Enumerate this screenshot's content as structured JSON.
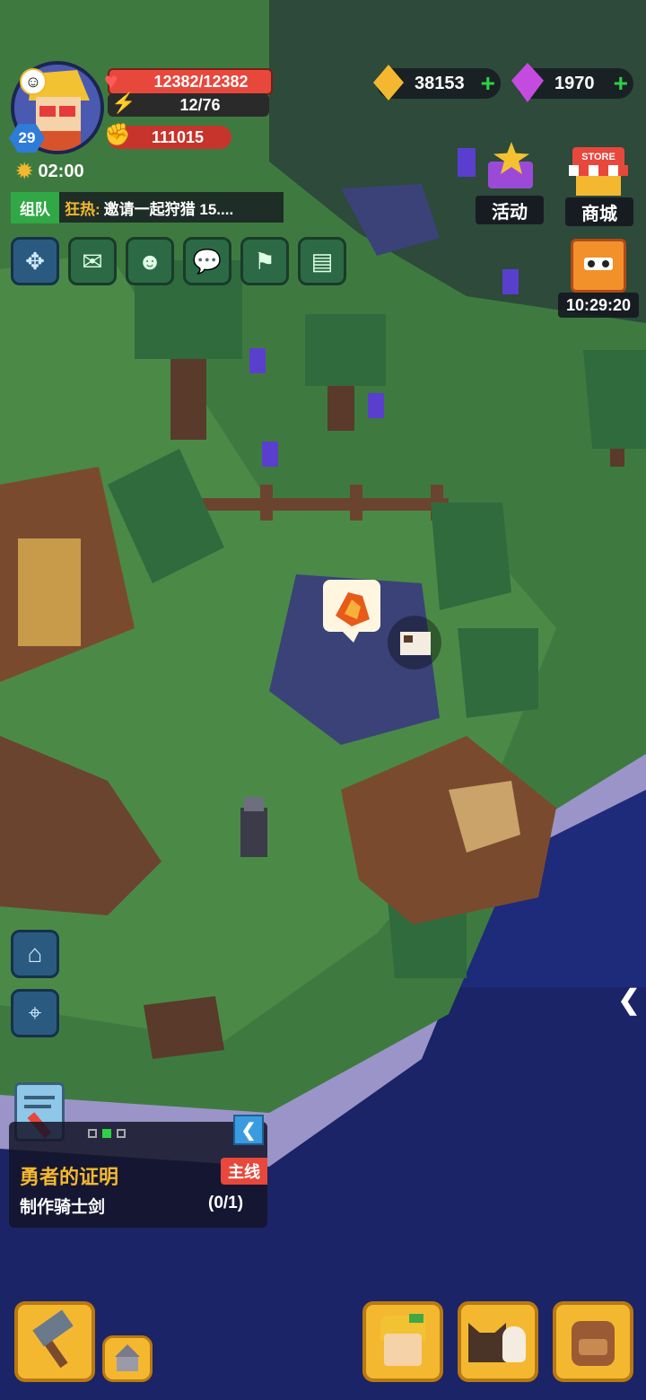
{
  "player": {
    "level": "29",
    "hp": "12382/12382",
    "energy": "12/76",
    "power": "111015",
    "timer": "02:00"
  },
  "resources": {
    "gold": "38153",
    "gems": "1970"
  },
  "team_chat": {
    "tag": "组队",
    "prefix": "狂热:",
    "message": "邀请一起狩猎 15...."
  },
  "top_right": {
    "events_label": "活动",
    "store_label": "商城",
    "store_sign": "STORE",
    "gift_timer": "10:29:20"
  },
  "quest": {
    "title": "勇者的证明",
    "badge": "主线",
    "task": "制作骑士剑",
    "progress": "(0/1)"
  },
  "colors": {
    "accent_red": "#e8473c",
    "gold": "#f4b830",
    "green_ui": "#2b6a45",
    "grass": "#3e7a40",
    "water": "#1e2a7a"
  },
  "icons": {
    "menu": [
      "expand-icon",
      "mail-icon",
      "friends-icon",
      "chat-icon",
      "map-icon",
      "clipboard-icon"
    ],
    "side": [
      "home-icon",
      "location-pin-icon"
    ],
    "bottom": [
      "hammer-icon",
      "build-icon",
      "hero-icon",
      "pets-icon",
      "backpack-icon"
    ]
  }
}
